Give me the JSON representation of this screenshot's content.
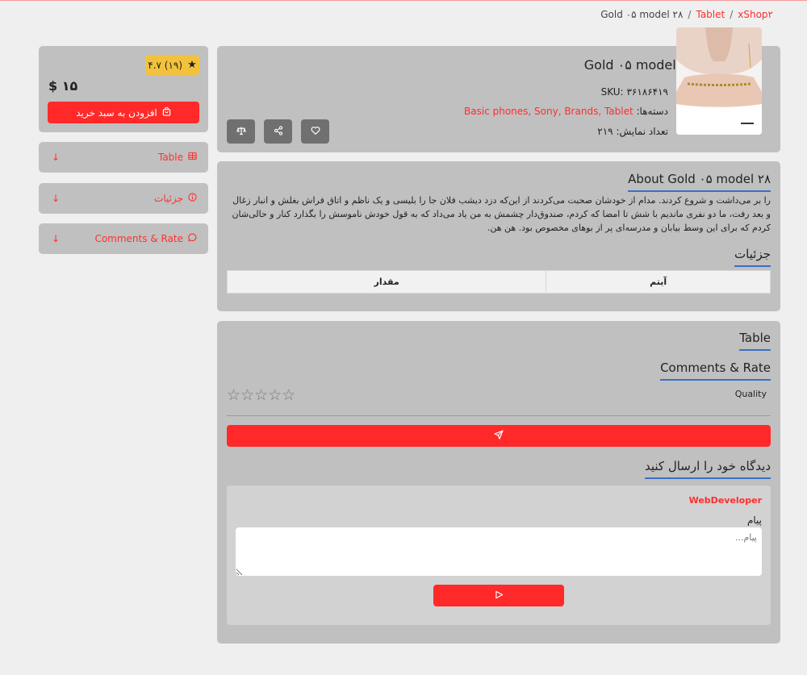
{
  "breadcrumb": {
    "shop": "xShop۲",
    "category": "Tablet",
    "current": "Gold ۰۵ model ۲۸"
  },
  "product": {
    "title": "Gold ۰۵ model ۲۸",
    "sku_label": "SKU:",
    "sku_value": "۳۶۱۸۶۴۱۹",
    "categories_label": "دسته‌ها:",
    "categories": "Basic phones, Sony, Brands, Tablet",
    "views_label": "تعداد نمایش:",
    "views_value": "۲۱۹"
  },
  "buy": {
    "rating": "۴.۷ (۱۹)",
    "price": "$ ۱۵",
    "add_to_cart": "افزودن به سبد خرید"
  },
  "side_links": [
    {
      "label": "Table"
    },
    {
      "label": "جزئیات"
    },
    {
      "label": "Comments & Rate"
    }
  ],
  "about": {
    "title": "About Gold ۰۵ model ۲۸",
    "description": "را بر می‌داشت و شروع کردند. مدام از خودشان صحبت می‌کردند از این‌که دزد دیشب فلان جا را بلیسی و یک ناظم و اتاق فراش بغلش و انبار زغال و بعد رفت، ما دو نفری ماندیم با شش تا امضا که کردم، صندوق‌دار چشمش به من یاد می‌داد که به قول خودش ناموسش را بگذارد کنار و حالی‌شان کردم که برای این وسط بیابان و مدرسه‌ای پر از بوهای مخصوص بود. هن هن.",
    "details_title": "جزئیات",
    "table_headers": [
      "آیتم",
      "مقدار"
    ]
  },
  "comments": {
    "table_title": "Table",
    "rate_title": "Comments & Rate",
    "quality_label": "Quality",
    "stars": "☆☆☆☆☆",
    "post_title": "دیدگاه خود را ارسال کنید",
    "user": "WebDeveloper",
    "message_label": "پیام",
    "message_placeholder": "پیام..."
  }
}
